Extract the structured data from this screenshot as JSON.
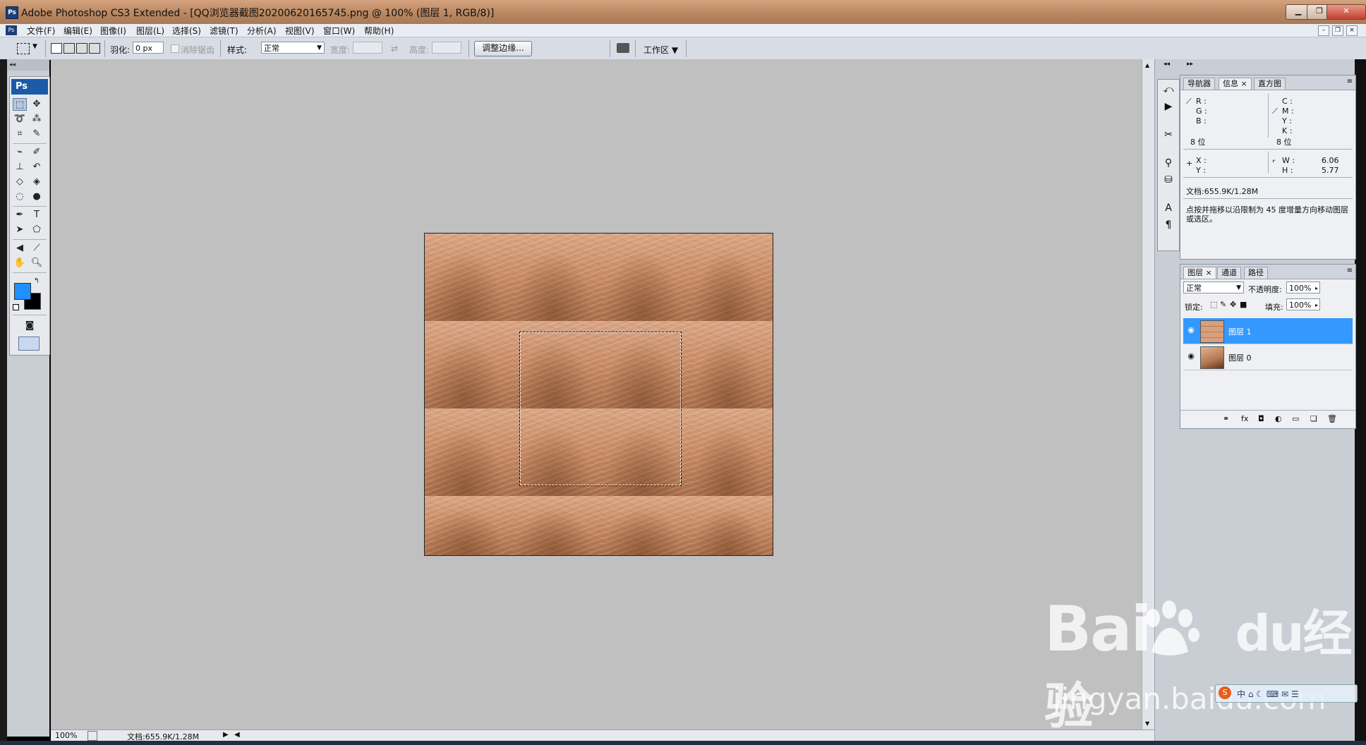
{
  "window": {
    "title": "Adobe Photoshop CS3 Extended - [QQ浏览器截图20200620165745.png @ 100% (图层 1, RGB/8)]",
    "app_icon": "Ps",
    "controls": [
      "minimize-icon",
      "restore-icon",
      "close-icon"
    ]
  },
  "menubar": {
    "items": [
      "文件(F)",
      "编辑(E)",
      "图像(I)",
      "图层(L)",
      "选择(S)",
      "滤镜(T)",
      "分析(A)",
      "视图(V)",
      "窗口(W)",
      "帮助(H)"
    ]
  },
  "options": {
    "feather_label": "羽化:",
    "feather_value": "0 px",
    "antialias_label": "消除锯齿",
    "style_label": "样式:",
    "style_value": "正常",
    "width_label": "宽度:",
    "height_label": "高度:",
    "refine_edge_button": "调整边缘...",
    "workspace_button": "工作区"
  },
  "toolbox": {
    "badge": "Ps",
    "foreground_color": "#1e90ff",
    "background_color": "#000000"
  },
  "info_panel": {
    "tabs": [
      "导航器",
      "信息",
      "直方图"
    ],
    "active_tab": "信息",
    "rgb_labels": [
      "R :",
      "G :",
      "B :"
    ],
    "cmyk_labels": [
      "C :",
      "M :",
      "Y :",
      "K :"
    ],
    "bits_left": "8 位",
    "bits_right": "8 位",
    "x_label": "X :",
    "y_label": "Y :",
    "w_label": "W :",
    "h_label": "H :",
    "w_value": "6.06",
    "h_value": "5.77",
    "doc_size": "文档:655.9K/1.28M",
    "hint": "点按并拖移以沿限制为 45 度增量方向移动图层或选区。"
  },
  "layers_panel": {
    "tabs": [
      "图层",
      "通道",
      "路径"
    ],
    "active_tab": "图层",
    "blend_mode": "正常",
    "opacity_label": "不透明度:",
    "opacity_value": "100%",
    "lock_label": "锁定:",
    "fill_label": "填充:",
    "fill_value": "100%",
    "layers": [
      {
        "name": "图层 1",
        "selected": true
      },
      {
        "name": "图层 0",
        "selected": false
      }
    ]
  },
  "status": {
    "zoom": "100%",
    "doc": "文档:655.9K/1.28M"
  },
  "watermark": {
    "brand": "Bai",
    "brand2": "du",
    "brand_cn": "经验",
    "url": "jingyan.baidu.com"
  },
  "colors": {
    "selection_highlight": "#3399ff",
    "canvas_bg": "#c0c0c0"
  }
}
